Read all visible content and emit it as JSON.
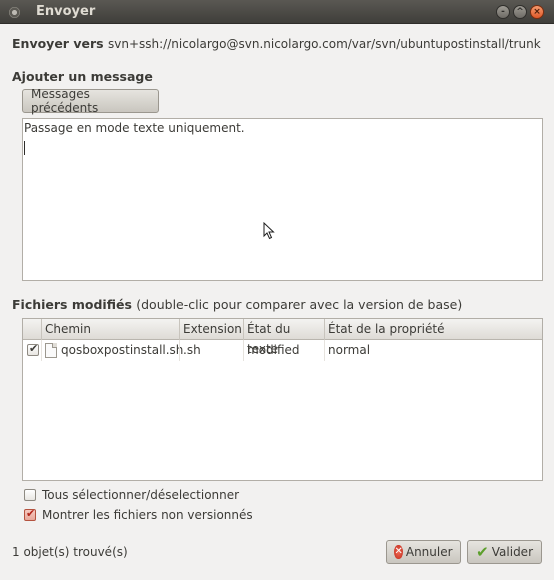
{
  "window": {
    "title": "Envoyer",
    "controls": {
      "minimize": "-",
      "maximize": "^",
      "close": "×"
    }
  },
  "header": {
    "send_label": "Envoyer vers",
    "send_url": "svn+ssh://nicolargo@svn.nicolargo.com/var/svn/ubuntupostinstall/trunk"
  },
  "message": {
    "heading": "Ajouter un message",
    "previous_button": "Messages précédents",
    "text": "Passage en mode texte uniquement."
  },
  "files": {
    "heading": "Fichiers modifiés",
    "hint": "(double-clic pour comparer avec la version de base)",
    "columns": [
      "Chemin",
      "Extension",
      "État du texte",
      "État de la propriété"
    ],
    "rows": [
      {
        "checked": true,
        "path": "qosboxpostinstall.sh",
        "extension": ".sh",
        "text_status": "modified",
        "prop_status": "normal"
      }
    ]
  },
  "options": {
    "select_all": {
      "label": "Tous sélectionner/déselectionner",
      "checked": false
    },
    "show_unversioned": {
      "label": "Montrer les fichiers non versionnés",
      "checked": true
    }
  },
  "footer": {
    "status": "1 objet(s) trouvé(s)",
    "cancel_label": "Annuler",
    "ok_label": "Valider"
  }
}
